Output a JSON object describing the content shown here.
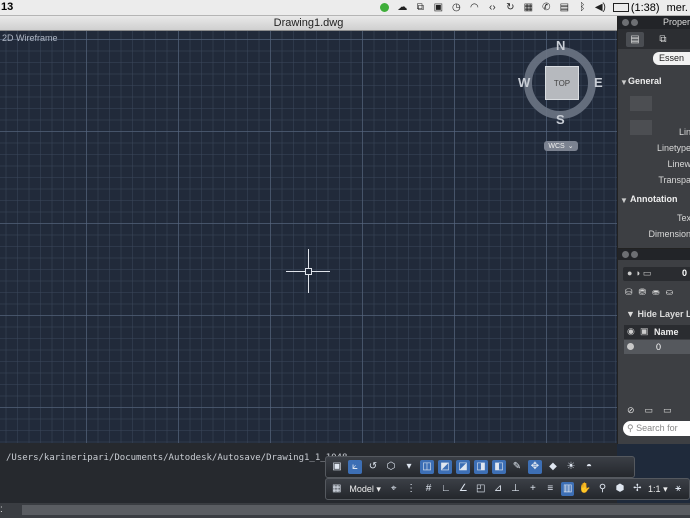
{
  "menubar": {
    "left_text": "13",
    "time": "(1:38)",
    "day": "mer.",
    "icons": [
      "green-dot-icon",
      "cloud-sync-icon",
      "share-icon",
      "window-icon",
      "time-machine-icon",
      "wifi-icon",
      "code-icon",
      "refresh-icon",
      "s-logo-icon",
      "phone-icon",
      "contact-icon",
      "bluetooth-icon",
      "volume-icon",
      "battery-icon"
    ]
  },
  "window": {
    "title": "Drawing1.dwg"
  },
  "canvas": {
    "view_label": "2D Wireframe",
    "viewcube": {
      "face": "TOP",
      "north": "N",
      "south": "S",
      "east": "E",
      "west": "W",
      "ucs": "WCS"
    }
  },
  "command": {
    "text": "/Users/karineripari/Documents/Autodesk/Autosave/Drawing1_1_1048"
  },
  "statusbar": {
    "left_label": ":"
  },
  "toolbar_bottom": {
    "model_label": "Model",
    "scale_label": "1:1"
  },
  "properties": {
    "title": "Proper",
    "essentials": "Essen",
    "general": {
      "title": "General",
      "labels": [
        "Lin",
        "Linetype",
        "Linew",
        "Transpa"
      ]
    },
    "annotation": {
      "title": "Annotation",
      "labels": [
        "Tex",
        "Dimension"
      ]
    }
  },
  "layers": {
    "current_value": "0",
    "hide_list": "Hide Layer List",
    "column_name": "Name",
    "rows": [
      {
        "name": "0"
      }
    ],
    "search_placeholder": "Search for"
  }
}
